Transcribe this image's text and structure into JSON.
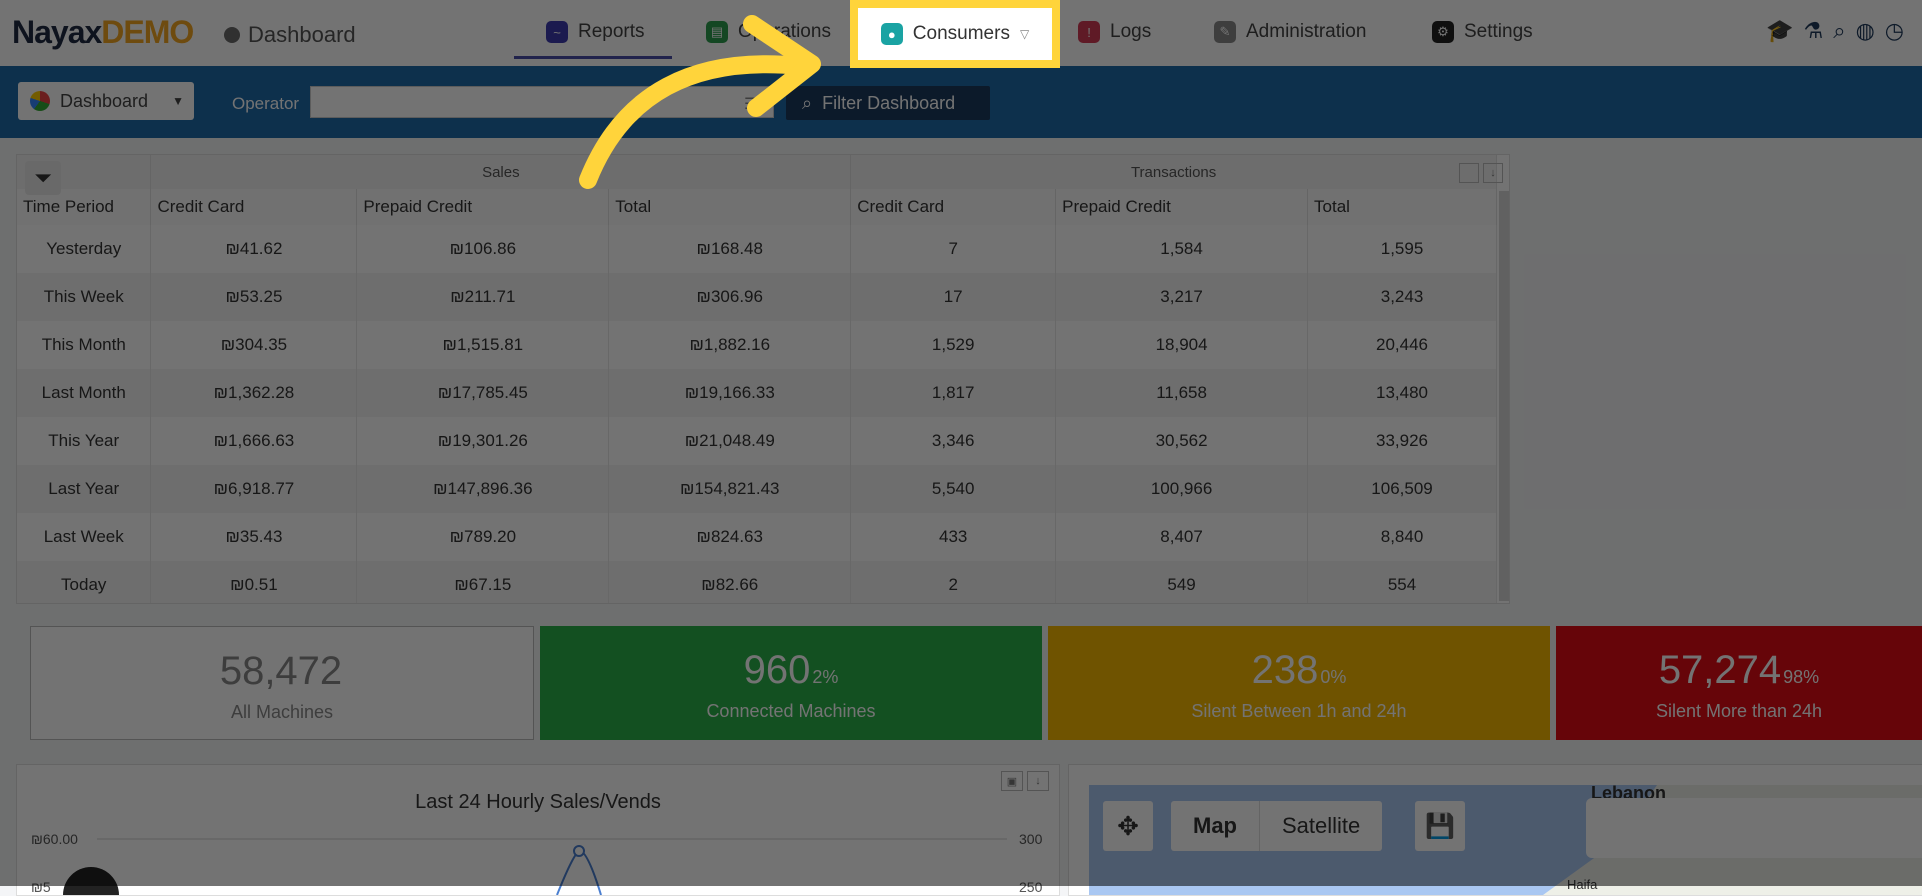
{
  "header": {
    "logo_main": "Nayax",
    "logo_demo": "DEMO",
    "breadcrumb": "Dashboard",
    "nav": [
      {
        "label": "Reports",
        "icon": "reports-icon"
      },
      {
        "label": "Operations",
        "icon": "operations-icon"
      },
      {
        "label": "Consumers",
        "icon": "consumers-icon"
      },
      {
        "label": "Logs",
        "icon": "logs-icon"
      },
      {
        "label": "Administration",
        "icon": "administration-icon"
      },
      {
        "label": "Settings",
        "icon": "settings-icon"
      }
    ],
    "right_icons": [
      "graduation-cap-icon",
      "flask-icon",
      "search-icon",
      "globe-icon",
      "clock-icon"
    ]
  },
  "filterbar": {
    "dashboard_select": "Dashboard",
    "operator_label": "Operator",
    "operator_value": "",
    "filter_button": "Filter Dashboard"
  },
  "table": {
    "group_headers": [
      "Sales",
      "Transactions"
    ],
    "columns": [
      "Time Period",
      "Credit Card",
      "Prepaid Credit",
      "Total",
      "Credit Card",
      "Prepaid Credit",
      "Total"
    ],
    "rows": [
      [
        "Yesterday",
        "₪41.62",
        "₪106.86",
        "₪168.48",
        "7",
        "1,584",
        "1,595"
      ],
      [
        "This Week",
        "₪53.25",
        "₪211.71",
        "₪306.96",
        "17",
        "3,217",
        "3,243"
      ],
      [
        "This Month",
        "₪304.35",
        "₪1,515.81",
        "₪1,882.16",
        "1,529",
        "18,904",
        "20,446"
      ],
      [
        "Last Month",
        "₪1,362.28",
        "₪17,785.45",
        "₪19,166.33",
        "1,817",
        "11,658",
        "13,480"
      ],
      [
        "This Year",
        "₪1,666.63",
        "₪19,301.26",
        "₪21,048.49",
        "3,346",
        "30,562",
        "33,926"
      ],
      [
        "Last Year",
        "₪6,918.77",
        "₪147,896.36",
        "₪154,821.43",
        "5,540",
        "100,966",
        "106,509"
      ],
      [
        "Last Week",
        "₪35.43",
        "₪789.20",
        "₪824.63",
        "433",
        "8,407",
        "8,840"
      ],
      [
        "Today",
        "₪0.51",
        "₪67.15",
        "₪82.66",
        "2",
        "549",
        "554"
      ]
    ]
  },
  "kpis": [
    {
      "value": "58,472",
      "pct": "",
      "label": "All Machines",
      "color": "#ffffff"
    },
    {
      "value": "960",
      "pct": "2%",
      "label": "Connected Machines",
      "color": "#2cb24a"
    },
    {
      "value": "238",
      "pct": "0%",
      "label": "Silent Between 1h and 24h",
      "color": "#f5b800"
    },
    {
      "value": "57,274",
      "pct": "98%",
      "label": "Silent More than 24h",
      "color": "#e20d14"
    }
  ],
  "chart": {
    "title": "Last 24 Hourly Sales/Vends",
    "y_left_top": "₪60.00",
    "y_left_2": "₪5",
    "y_right_top": "300",
    "y_right_2": "250"
  },
  "map": {
    "button_map": "Map",
    "button_satellite": "Satellite",
    "label_lebanon": "Lebanon",
    "label_haifa": "Haifa"
  },
  "colors": {
    "accent": "#1e6aa8",
    "highlight": "#ffd43b"
  }
}
